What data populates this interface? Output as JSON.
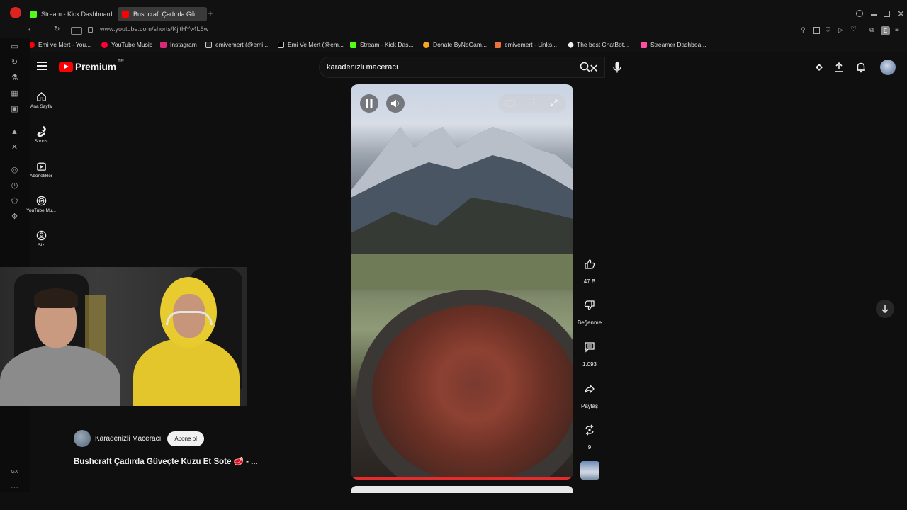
{
  "browser": {
    "tabs": [
      {
        "label": "Stream - Kick Dashboard",
        "active": false
      },
      {
        "label": "Bushcraft Çadırda Gü",
        "active": true
      }
    ],
    "url": "www.youtube.com/shorts/KjltHYv4L6w",
    "bookmarks": [
      {
        "label": "Emi ve Mert - You...",
        "color": "#ff0000"
      },
      {
        "label": "YouTube Music",
        "color": "#ff0033"
      },
      {
        "label": "Instagram",
        "color": "#d62976"
      },
      {
        "label": "emivemert (@emi...",
        "color": "#ffffff"
      },
      {
        "label": "Emi Ve Mert (@em...",
        "color": "#ffffff"
      },
      {
        "label": "Stream - Kick Das...",
        "color": "#53fc18"
      },
      {
        "label": "Donate ByNoGam...",
        "color": "#f5a623"
      },
      {
        "label": "emivemert - Links...",
        "color": "#e8743b"
      },
      {
        "label": "The best ChatBot...",
        "color": "#ffffff"
      },
      {
        "label": "Streamer Dashboa...",
        "color": "#ff4fa0"
      }
    ]
  },
  "youtube": {
    "logo_text": "Premium",
    "region": "TR",
    "search_value": "karadenizli maceracı",
    "nav": [
      {
        "label": "Ana Sayfa",
        "icon": "home-icon"
      },
      {
        "label": "Shorts",
        "icon": "shorts-icon"
      },
      {
        "label": "Abonelikler",
        "icon": "subscriptions-icon"
      },
      {
        "label": "YouTube Mu...",
        "icon": "youtube-music-icon"
      },
      {
        "label": "Siz",
        "icon": "you-icon"
      }
    ],
    "actions": {
      "likes": "47 B",
      "dislike_label": "Beğenme",
      "comments": "1.093",
      "share_label": "Paylaş",
      "remix_count": "9"
    },
    "channel_name": "Karadenizli Maceracı",
    "subscribe_label": "Abone ol",
    "video_title": "Bushcraft Çadırda Güveçte Kuzu Et Sote 🥩 - ...",
    "progress": 1.0
  },
  "colors": {
    "accent": "#ff0000",
    "background": "#0f0f0f"
  }
}
